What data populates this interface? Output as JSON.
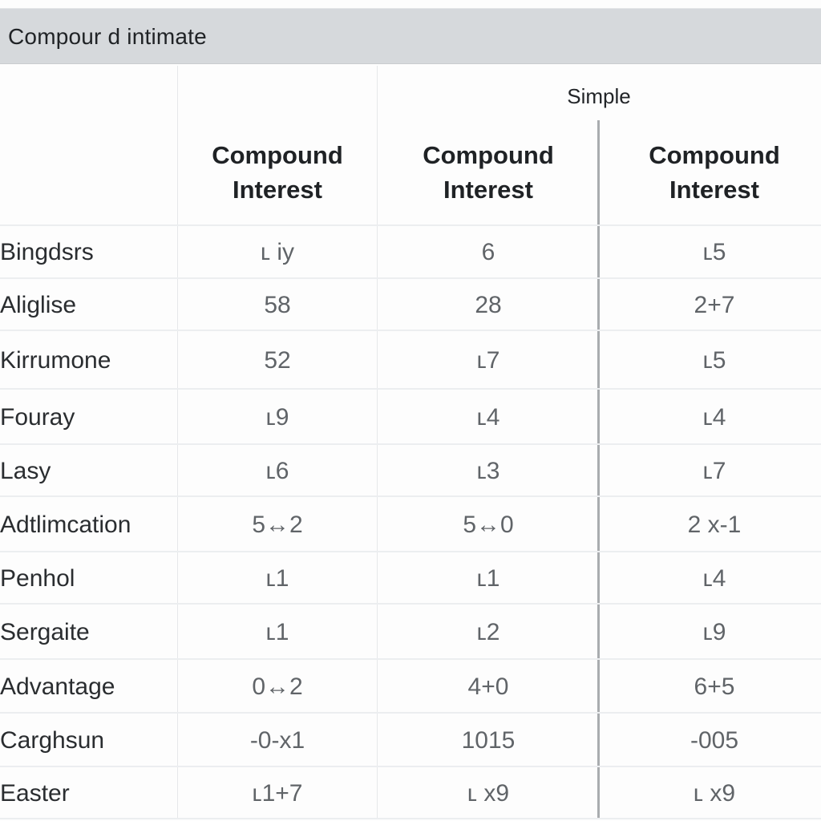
{
  "title": "Compour d intimate",
  "header": {
    "group_label": "Simple",
    "columns": [
      {
        "line1": "Compound",
        "line2": "Interest"
      },
      {
        "line1": "Compound",
        "line2": "Interest"
      },
      {
        "line1": "Compound",
        "line2": "Interest"
      }
    ]
  },
  "rows": [
    {
      "label": "Bingdsrs",
      "values": [
        "ʟ iy",
        "6",
        "ʟ5"
      ]
    },
    {
      "label": "Aliglise",
      "values": [
        "58",
        "28",
        "2+7"
      ]
    },
    {
      "label": "Kirrumone",
      "values": [
        "52",
        "ʟ7",
        "ʟ5"
      ]
    },
    {
      "label": "Fouray",
      "values": [
        "ʟ9",
        "ʟ4",
        "ʟ4"
      ]
    },
    {
      "label": "Lasy",
      "values": [
        "ʟ6",
        "ʟ3",
        "ʟ7"
      ]
    },
    {
      "label": "Adtlimcation",
      "values": [
        "5↔2",
        "5↔0",
        "2 x-1"
      ]
    },
    {
      "label": "Penhol",
      "values": [
        "ʟ1",
        "ʟ1",
        "ʟ4"
      ]
    },
    {
      "label": "Sergaite",
      "values": [
        "ʟ1",
        "ʟ2",
        "ʟ9"
      ]
    },
    {
      "label": "Advantage",
      "values": [
        "0↔2",
        "4+0",
        "6+5"
      ]
    },
    {
      "label": "Carghsun",
      "values": [
        "-0-x1",
        "1015",
        "-005"
      ]
    },
    {
      "label": "Easter",
      "values": [
        "ʟ1+7",
        "ʟ x9",
        "ʟ x9"
      ]
    }
  ]
}
